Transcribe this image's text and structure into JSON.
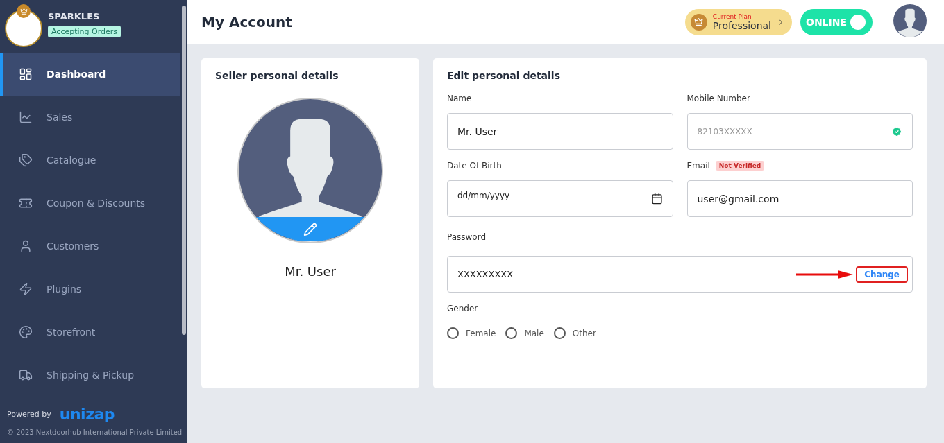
{
  "store": {
    "name": "SPARKLES",
    "status": "Accepting Orders"
  },
  "sidebar": {
    "items": [
      {
        "label": "Dashboard",
        "kind": "dashboard",
        "selected": true
      },
      {
        "label": "Sales",
        "kind": "sales",
        "selected": false
      },
      {
        "label": "Catalogue",
        "kind": "catalogue",
        "selected": false
      },
      {
        "label": "Coupon & Discounts",
        "kind": "coupon",
        "selected": false
      },
      {
        "label": "Customers",
        "kind": "customers",
        "selected": false
      },
      {
        "label": "Plugins",
        "kind": "plugins",
        "selected": false
      },
      {
        "label": "Storefront",
        "kind": "storefront",
        "selected": false
      },
      {
        "label": "Shipping & Pickup",
        "kind": "shipping",
        "selected": false
      }
    ],
    "powered_by": "Powered by",
    "brand": "unizap",
    "copyright": "© 2023 Nextdoorhub International Private Limited"
  },
  "header": {
    "title": "My Account",
    "plan": {
      "caption": "Current Plan",
      "name": "Professional"
    },
    "status_toggle": {
      "label": "ONLINE",
      "on": true
    }
  },
  "seller_card": {
    "title": "Seller personal details",
    "name": "Mr. User"
  },
  "edit_card": {
    "title": "Edit personal details",
    "name": {
      "label": "Name",
      "value": "Mr. User"
    },
    "mobile": {
      "label": "Mobile Number",
      "placeholder": "82103XXXXX",
      "verified": true
    },
    "dob": {
      "label": "Date Of Birth",
      "value": "dd/mm/yyyy"
    },
    "email": {
      "label": "Email",
      "badge": "Not Verified",
      "value": "user@gmail.com"
    },
    "password": {
      "label": "Password",
      "value": "XXXXXXXXX",
      "action": "Change"
    },
    "gender": {
      "label": "Gender",
      "options": [
        {
          "label": "Female",
          "selected": false
        },
        {
          "label": "Male",
          "selected": false
        },
        {
          "label": "Other",
          "selected": false
        }
      ]
    }
  }
}
